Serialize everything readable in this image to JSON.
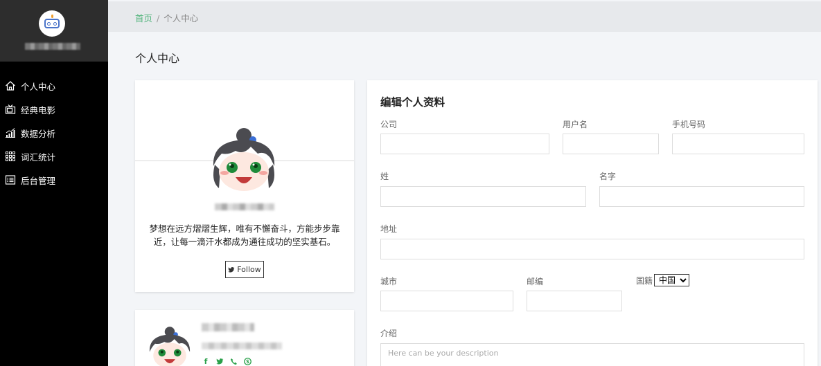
{
  "breadcrumb": {
    "home": "首页",
    "separator": "/",
    "current": "个人中心"
  },
  "page_title": "个人中心",
  "sidebar": {
    "items": [
      {
        "label": "个人中心",
        "icon": "home-icon"
      },
      {
        "label": "经典电影",
        "icon": "tv-icon"
      },
      {
        "label": "数据分析",
        "icon": "chart-icon"
      },
      {
        "label": "词汇统计",
        "icon": "grid-icon"
      },
      {
        "label": "后台管理",
        "icon": "list-icon"
      }
    ]
  },
  "profile": {
    "motto": "梦想在远方熠熠生辉，唯有不懈奋斗，方能步步靠近，让每一滴汗水都成为通往成功的坚实基石。",
    "follow_label": "Follow"
  },
  "card2": {
    "social_icons": [
      "facebook-icon",
      "twitter-icon",
      "phone-icon",
      "skype-icon"
    ]
  },
  "edit_form": {
    "title": "编辑个人资料",
    "company_label": "公司",
    "username_label": "用户名",
    "phone_label": "手机号码",
    "lastname_label": "姓",
    "firstname_label": "名字",
    "address_label": "地址",
    "city_label": "城市",
    "zip_label": "邮编",
    "country_label": "国籍",
    "country_value": "中国",
    "intro_label": "介绍",
    "intro_placeholder": "Here can be your description"
  },
  "colors": {
    "sidebar_bg": "#000000",
    "sidebar_top_bg": "#2d2d2d",
    "accent_green": "#55b57e",
    "social_green": "#2aa04a"
  }
}
